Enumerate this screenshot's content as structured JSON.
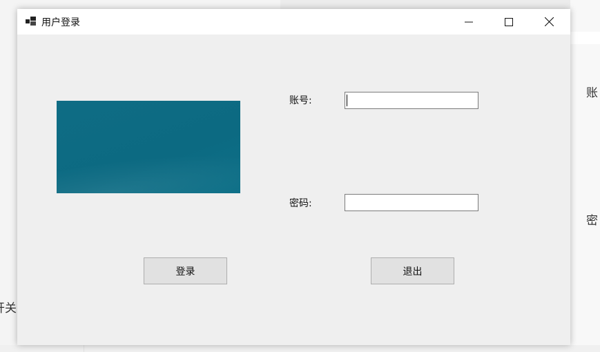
{
  "window": {
    "title": "用户登录",
    "controls": {
      "minimize_icon": "minimize-icon",
      "maximize_icon": "maximize-icon",
      "close_icon": "close-icon"
    }
  },
  "form": {
    "account_label": "账号:",
    "account_value": "",
    "password_label": "密码:",
    "password_value": "",
    "login_button": "登录",
    "exit_button": "退出"
  },
  "background": {
    "text_right_1": "账",
    "text_right_2": "密",
    "text_left": "开关"
  },
  "colors": {
    "picture": "#0e6c84",
    "window_bg": "#efefef",
    "button_bg": "#e1e1e1"
  }
}
